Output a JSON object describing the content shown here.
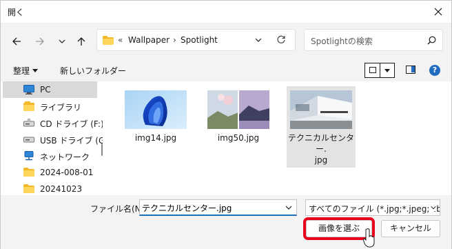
{
  "window": {
    "title": "開く"
  },
  "nav": {
    "breadcrumb_overflow": "«",
    "path": [
      "Wallpaper",
      "Spotlight"
    ],
    "search_placeholder": "Spotlightの検索"
  },
  "toolbar": {
    "organize": "整理",
    "new_folder": "新しいフォルダー"
  },
  "sidebar": {
    "items": [
      {
        "label": "PC",
        "icon": "pc-icon",
        "selected": true
      },
      {
        "label": "ライブラリ",
        "icon": "library-icon"
      },
      {
        "label": "CD ドライブ (F:)",
        "icon": "cd-drive-icon"
      },
      {
        "label": "USB ドライブ (G:)",
        "icon": "usb-drive-icon"
      },
      {
        "label": "ネットワーク",
        "icon": "network-icon"
      },
      {
        "label": "2024-008-01",
        "icon": "folder-icon"
      },
      {
        "label": "20241023",
        "icon": "folder-icon"
      }
    ]
  },
  "files": [
    {
      "name": "img14.jpg"
    },
    {
      "name": "img50.jpg"
    },
    {
      "name_line1": "テクニカルセンター.",
      "name_line2": "jpg",
      "selected": true
    }
  ],
  "bottom": {
    "filename_label": "ファイル名(N):",
    "filename_value": "テクニカルセンター.jpg",
    "filetype_value": "すべてのファイル (*.jpg;*.jpeg;*.bmp",
    "select_button": "画像を選ぶ",
    "cancel_button": "キャンセル"
  },
  "colors": {
    "accent": "#1f6cc1",
    "highlight_box": "#e8001f",
    "selection": "#e3e3e3"
  }
}
